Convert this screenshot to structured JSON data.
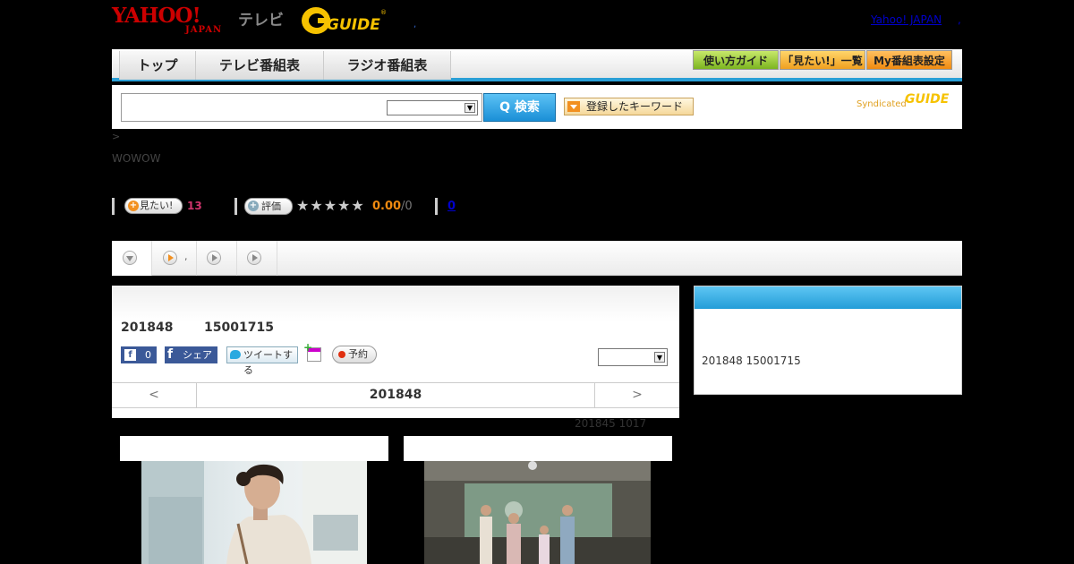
{
  "header": {
    "yahoo_logo": "YAHOO!",
    "yahoo_japan": "JAPAN",
    "tv_label": "テレビ",
    "gguide_logo": "GUIDE",
    "dot": ",",
    "yahoo_japan_link": "Yahoo! JAPAN",
    "link_sep": ","
  },
  "nav": {
    "tabs": [
      {
        "label": "トップ"
      },
      {
        "label": "テレビ番組表"
      },
      {
        "label": "ラジオ番組表"
      }
    ],
    "buttons": {
      "guide": "使い方ガイド",
      "want_list": "「見たい!」一覧",
      "my_schedule": "My番組表設定"
    }
  },
  "search": {
    "input_value": "",
    "select_value": "",
    "button_label": "Q 検索",
    "keyword_button": "登録したキーワード",
    "syndicated": "Syndicated",
    "syndicated_logo": "GUIDE"
  },
  "breadcrumb": ">",
  "channel": "WOWOW",
  "ratings": {
    "want_label": "見たい!",
    "want_count": "13",
    "eval_label": "評価",
    "stars": "★★★★★",
    "score": "0.00",
    "score_den": "/0",
    "review_count": "0"
  },
  "subtabs": [
    {
      "label": ""
    },
    {
      "label": ","
    },
    {
      "label": ""
    },
    {
      "label": ""
    }
  ],
  "program": {
    "air_date": "201848",
    "air_time": "15001715",
    "fb_like_count": "0",
    "fb_share": "シェア",
    "tweet": "ツイートする",
    "reserve": "予約",
    "select_value": ""
  },
  "date_nav": {
    "prev": "<",
    "current": "201848",
    "next": ">"
  },
  "updated": "201845  1017",
  "side": {
    "text": "201848  15001715"
  },
  "colors": {
    "accent_blue": "#2a9fd6",
    "want_pink": "#d0346c",
    "score_orange": "#f08a10",
    "yahoo_red": "#cc0000"
  }
}
